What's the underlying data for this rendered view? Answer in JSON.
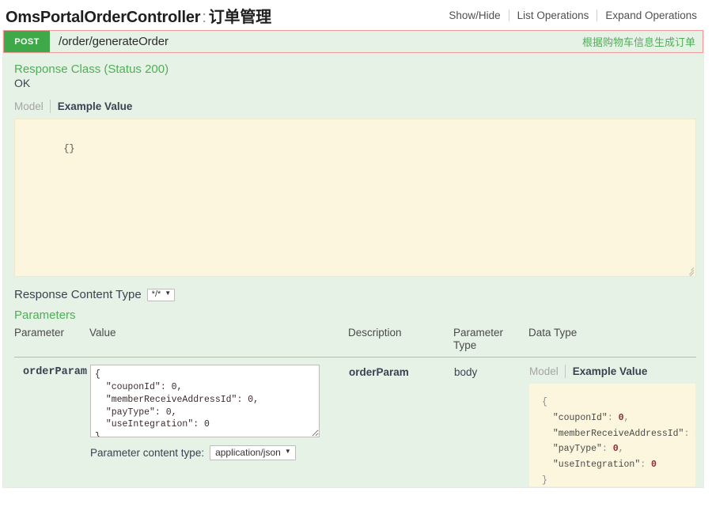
{
  "header": {
    "controller_name": "OmsPortalOrderController",
    "separator": ":",
    "controller_cn": "订单管理",
    "links": [
      {
        "label": "Show/Hide"
      },
      {
        "label": "List Operations"
      },
      {
        "label": "Expand Operations"
      }
    ]
  },
  "operation": {
    "method": "POST",
    "path": "/order/generateOrder",
    "summary_cn": "根据购物车信息生成订单",
    "accent_green": "#3fa94a",
    "highlight_border": "#f19a9a",
    "section_bg": "#e7f2e6",
    "example_bg": "#fbf6dd"
  },
  "response": {
    "class_title": "Response Class (Status 200)",
    "status_text": "OK",
    "tabs": [
      {
        "label": "Model",
        "active": false
      },
      {
        "label": "Example Value",
        "active": true
      }
    ],
    "example_value": "{}"
  },
  "response_content_type": {
    "label": "Response Content Type",
    "selected": "*/*",
    "caret": "▼"
  },
  "parameters_section": {
    "title": "Parameters",
    "columns": [
      "Parameter",
      "Value",
      "Description",
      "Parameter\nType",
      "Data Type"
    ],
    "column_parameter": "Parameter",
    "column_value": "Value",
    "column_description": "Description",
    "column_parameter_type_line1": "Parameter",
    "column_parameter_type_line2": "Type",
    "column_data_type": "Data Type",
    "rows": [
      {
        "name": "orderParam",
        "value": "{\n  \"couponId\": 0,\n  \"memberReceiveAddressId\": 0,\n  \"payType\": 0,\n  \"useIntegration\": 0\n}",
        "description": "orderParam",
        "parameter_type": "body",
        "data_type_tabs": [
          {
            "label": "Model",
            "active": false
          },
          {
            "label": "Example Value",
            "active": true
          }
        ],
        "data_type_example": {
          "open_brace": "{",
          "fields": [
            {
              "key": "\"couponId\"",
              "value": "0",
              "comma": ","
            },
            {
              "key": "\"memberReceiveAddressId\"",
              "value": "0",
              "comma": ","
            },
            {
              "key": "\"payType\"",
              "value": "0",
              "comma": ","
            },
            {
              "key": "\"useIntegration\"",
              "value": "0",
              "comma": ""
            }
          ],
          "close_brace": "}"
        },
        "content_type_label": "Parameter content type:",
        "content_type_selected": "application/json",
        "content_type_caret": "▼"
      }
    ]
  }
}
